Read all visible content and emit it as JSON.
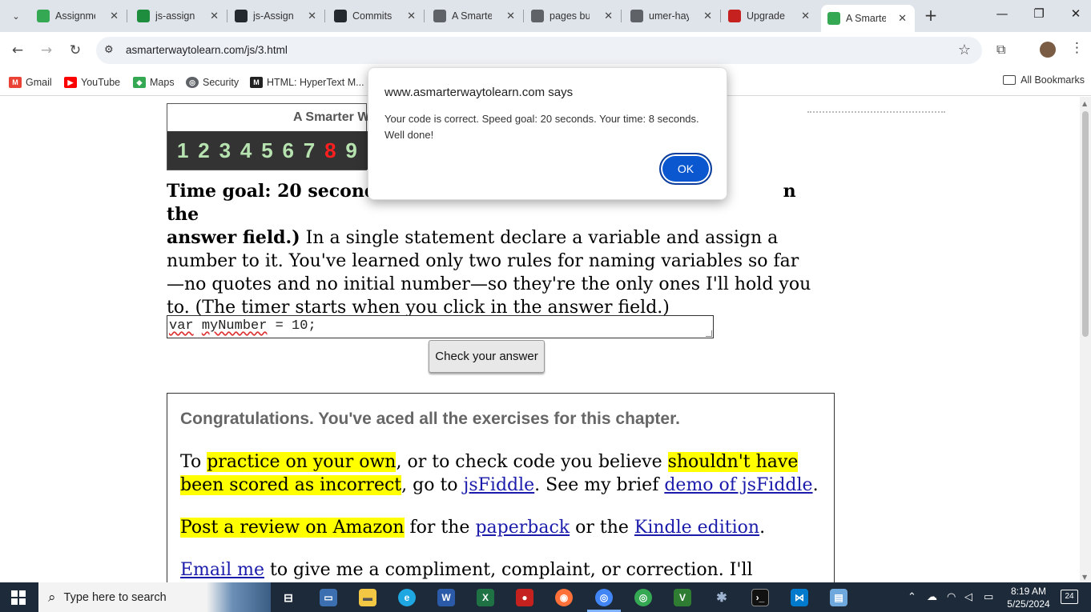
{
  "browser": {
    "tabs": [
      {
        "title": "Assignme",
        "icon": "classroom-icon",
        "color": "#34a853"
      },
      {
        "title": "js-assignr",
        "icon": "classroom-icon",
        "color": "#1e8e3e"
      },
      {
        "title": "js-Assignr",
        "icon": "github-icon",
        "color": "#24292f"
      },
      {
        "title": "Commits",
        "icon": "github-icon",
        "color": "#24292f"
      },
      {
        "title": "A Smarter",
        "icon": "globe-icon",
        "color": "#5f6368"
      },
      {
        "title": "pages buil",
        "icon": "github-actions-icon",
        "color": "#5f6368"
      },
      {
        "title": "umer-hay",
        "icon": "globe-icon",
        "color": "#5f6368"
      },
      {
        "title": "Upgrade t",
        "icon": "record-icon",
        "color": "#c5221f"
      },
      {
        "title": "A Smarter",
        "icon": "s-logo-icon",
        "color": "#34a853",
        "active": true
      }
    ],
    "url": "asmarterwaytolearn.com/js/3.html",
    "bookmarks": [
      "Gmail",
      "YouTube",
      "Maps",
      "Security",
      "HTML: HyperText M..."
    ],
    "all_bookmarks": "All Bookmarks"
  },
  "page": {
    "banner_title": "A Smarter W",
    "numbers": [
      "1",
      "2",
      "3",
      "4",
      "5",
      "6",
      "7",
      "8",
      "9"
    ],
    "current_number": "8",
    "instruction_bold_1": "Time goal: 20 seconds",
    "instruction_bold_2": "answer field.)",
    "instruction_bold_3": "n the",
    "instruction_text": "In a single statement declare a variable and assign a number to it. You've learned only two rules for naming variables so far—no quotes and no initial number—so they're the only ones I'll hold you to. (The timer starts when you click in the answer field.)",
    "answer_value": "var myNumber = 10;",
    "answer_tokens": [
      "var",
      " ",
      "myNumber",
      " = 10;"
    ],
    "check_button": "Check your answer",
    "congrats_heading": "Congratulations. You've aced all the exercises for this chapter.",
    "p1": {
      "t1": "To ",
      "hl1": "practice on your own",
      "t2": ", or to check code you believe ",
      "hl2": "shouldn't have been scored as incorrect",
      "t3": ", go to ",
      "link1": "jsFiddle",
      "t4": ". See my brief ",
      "link2": "demo of jsFiddle",
      "t5": "."
    },
    "p2": {
      "hl": "Post a review on Amazon",
      "t1": " for the ",
      "link1": "paperback",
      "t2": " or the ",
      "link2": "Kindle edition",
      "t3": "."
    },
    "p3": {
      "link": "Email me",
      "t1": " to give me a compliment, complaint, or correction. I'll respond."
    }
  },
  "alert": {
    "origin": "www.asmarterwaytolearn.com says",
    "message": "Your code is correct. Speed goal: 20 seconds. Your time: 8 seconds. Well done!",
    "ok": "OK"
  },
  "taskbar": {
    "search_placeholder": "Type here to search",
    "time": "8:19 AM",
    "date": "5/25/2024",
    "notifications": "24"
  }
}
